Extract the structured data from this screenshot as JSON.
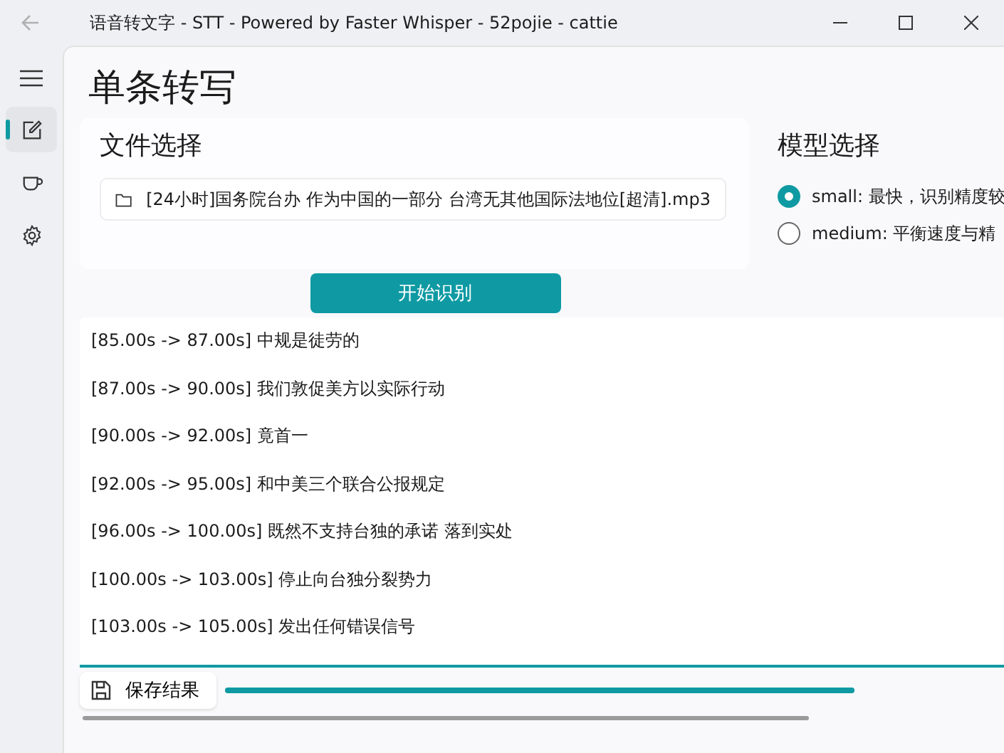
{
  "window": {
    "title": "语音转文字 - STT - Powered by Faster Whisper - 52pojie - cattie"
  },
  "nav": {
    "items": [
      {
        "kind": "edit",
        "selected": true
      },
      {
        "kind": "cup",
        "selected": false
      },
      {
        "kind": "gear",
        "selected": false
      }
    ]
  },
  "page": {
    "heading": "单条转写"
  },
  "file_section": {
    "title": "文件选择",
    "file": "[24小时]国务院台办 作为中国的一部分 台湾无其他国际法地位[超清].mp3"
  },
  "model_section": {
    "title": "模型选择",
    "options": [
      {
        "label": "small: 最快，识别精度较",
        "selected": true
      },
      {
        "label": "medium: 平衡速度与精",
        "selected": false
      }
    ]
  },
  "start_button": "开始识别",
  "output_lines": [
    "[85.00s -> 87.00s] 中规是徒劳的",
    "[87.00s -> 90.00s] 我们敦促美方以实际行动",
    "[90.00s -> 92.00s] 竟首一",
    "[92.00s -> 95.00s] 和中美三个联合公报规定",
    "[96.00s -> 100.00s] 既然不支持台独的承诺 落到实处",
    "[100.00s -> 103.00s] 停止向台独分裂势力",
    "[103.00s -> 105.00s] 发出任何错误信号"
  ],
  "save_button": "保存结果",
  "progress": {
    "level": 1
  }
}
